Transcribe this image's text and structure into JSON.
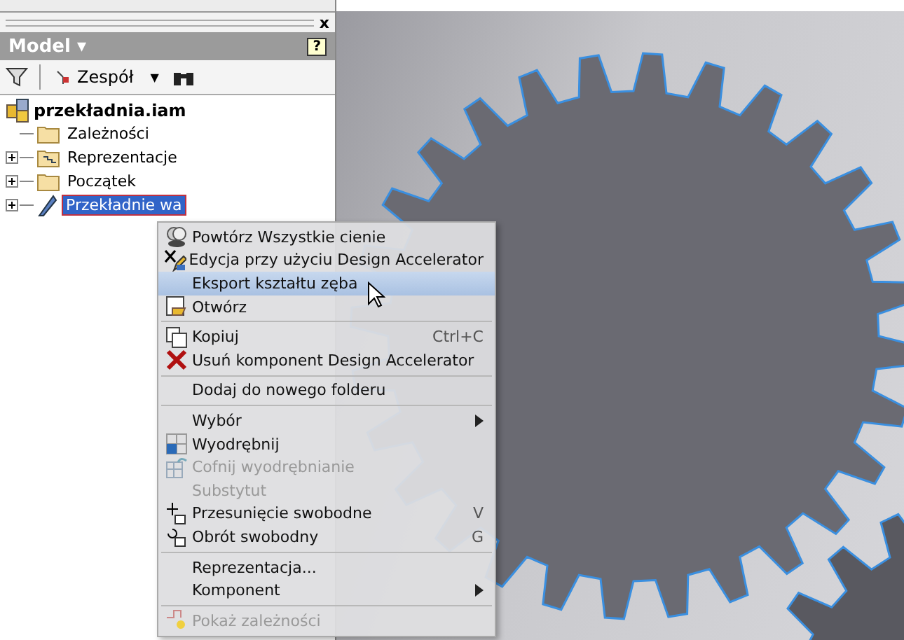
{
  "panel": {
    "close": "x",
    "title": "Model ▾",
    "help": "?",
    "toolbar": {
      "dropdown": "Zespół",
      "caret": "▼"
    }
  },
  "tree": {
    "label": "przekładnia.iam",
    "children": [
      {
        "label": "Zależności",
        "expandable": false,
        "selected": false
      },
      {
        "label": "Reprezentacje",
        "expandable": true,
        "selected": false
      },
      {
        "label": "Początek",
        "expandable": true,
        "selected": false
      },
      {
        "label": "Przekładnie wa",
        "expandable": true,
        "selected": true
      }
    ]
  },
  "context_menu": {
    "sections": [
      [
        {
          "label": "Powtórz Wszystkie cienie",
          "submenu": false,
          "disabled": false,
          "selected": false
        },
        {
          "label": "Edycja przy użyciu Design Accelerator",
          "submenu": false,
          "disabled": false,
          "selected": false
        },
        {
          "label": "Eksport kształtu zęba",
          "submenu": false,
          "disabled": false,
          "selected": true
        },
        {
          "label": "Otwórz",
          "submenu": false,
          "disabled": false,
          "selected": false
        }
      ],
      [
        {
          "label": "Kopiuj",
          "shortcut": "Ctrl+C",
          "submenu": false,
          "disabled": false,
          "selected": false
        },
        {
          "label": "Usuń komponent Design Accelerator",
          "submenu": false,
          "disabled": false,
          "selected": false
        }
      ],
      [
        {
          "label": "Dodaj do nowego folderu",
          "submenu": false,
          "disabled": false,
          "selected": false
        }
      ],
      [
        {
          "label": "Wybór",
          "submenu": true,
          "disabled": false,
          "selected": false
        },
        {
          "label": "Wyodrębnij",
          "submenu": false,
          "disabled": false,
          "selected": false
        },
        {
          "label": "Cofnij wyodrębnianie",
          "submenu": false,
          "disabled": true,
          "selected": false
        },
        {
          "label": "Substytut",
          "submenu": false,
          "disabled": true,
          "selected": false
        },
        {
          "label": "Przesunięcie swobodne",
          "shortcut": "V",
          "submenu": false,
          "disabled": false,
          "selected": false
        },
        {
          "label": "Obrót swobodny",
          "shortcut": "G",
          "submenu": false,
          "disabled": false,
          "selected": false
        }
      ],
      [
        {
          "label": "Reprezentacja...",
          "submenu": false,
          "disabled": false,
          "selected": false
        },
        {
          "label": "Komponent",
          "submenu": true,
          "disabled": false,
          "selected": false
        }
      ],
      [
        {
          "label": "Pokaż zależności",
          "submenu": false,
          "disabled": true,
          "selected": false
        }
      ]
    ]
  }
}
